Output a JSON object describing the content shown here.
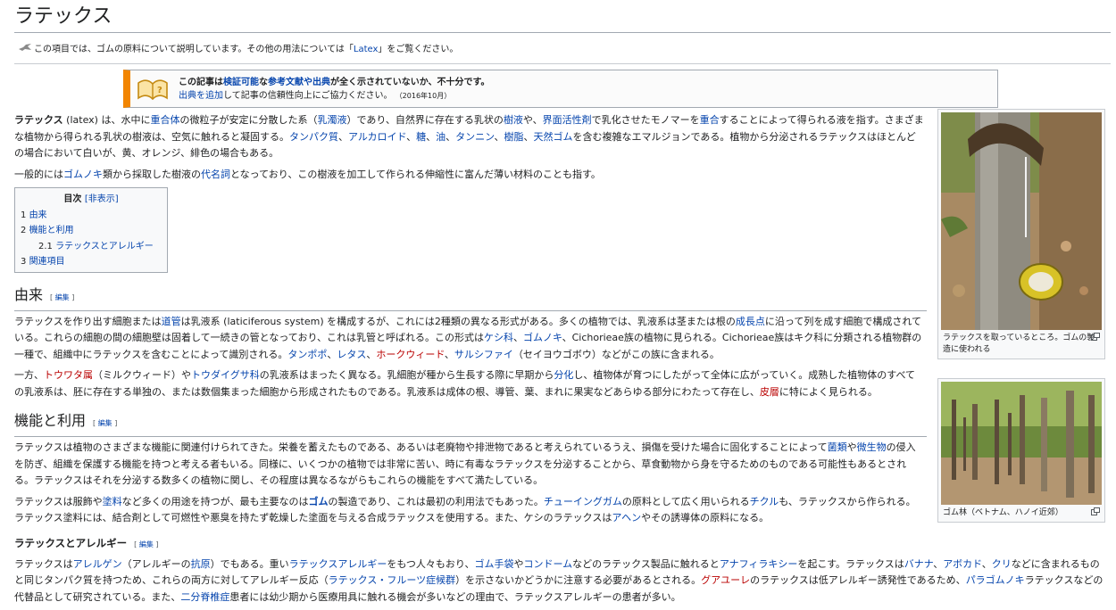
{
  "page_title": "ラテックス",
  "hatnote": {
    "text_pre": "この項目では、ゴムの原料について説明しています。その他の用法については「",
    "link": "Latex",
    "text_post": "」をご覧ください。"
  },
  "ambox": {
    "l1_a": "この記事は",
    "l1_link1": "検証可能",
    "l1_b": "な",
    "l1_link2": "参考文献や出典",
    "l1_c": "が全く示されていないか、不十分です。",
    "l2_link": "出典を追加",
    "l2_text": "して記事の信頼性向上にご協力ください。",
    "date": "（2016年10月）"
  },
  "intro": {
    "p1": [
      {
        "t": "ラテックス",
        "b": true
      },
      {
        "t": " (latex) は、水中に"
      },
      {
        "t": "重合体",
        "l": true
      },
      {
        "t": "の微粒子が安定に分散した系（"
      },
      {
        "t": "乳濁液",
        "l": true
      },
      {
        "t": "）であり、自然界に存在する乳状の"
      },
      {
        "t": "樹液",
        "l": true
      },
      {
        "t": "や、"
      },
      {
        "t": "界面活性剤",
        "l": true
      },
      {
        "t": "で乳化させたモノマーを"
      },
      {
        "t": "重合",
        "l": true
      },
      {
        "t": "することによって得られる液を指す。さまざまな植物から得られる乳状の樹液は、空気に触れると凝固する。"
      },
      {
        "t": "タンパク質",
        "l": true
      },
      {
        "t": "、"
      },
      {
        "t": "アルカロイド",
        "l": true
      },
      {
        "t": "、"
      },
      {
        "t": "糖",
        "l": true
      },
      {
        "t": "、"
      },
      {
        "t": "油",
        "l": true
      },
      {
        "t": "、"
      },
      {
        "t": "タンニン",
        "l": true
      },
      {
        "t": "、"
      },
      {
        "t": "樹脂",
        "l": true
      },
      {
        "t": "、"
      },
      {
        "t": "天然ゴム",
        "l": true
      },
      {
        "t": "を含む複雑なエマルジョンである。植物から分泌されるラテックスはほとんどの場合において白いが、黄、オレンジ、緋色の場合もある。"
      }
    ],
    "p2": [
      {
        "t": "一般的には"
      },
      {
        "t": "ゴムノキ",
        "l": true
      },
      {
        "t": "類から採取した樹液の"
      },
      {
        "t": "代名詞",
        "l": true
      },
      {
        "t": "となっており、この樹液を加工して作られる伸縮性に富んだ薄い材料のことも指す。"
      }
    ]
  },
  "toc": {
    "title": "目次",
    "toggle": "[非表示]",
    "items": [
      {
        "num": "1",
        "label": "由来"
      },
      {
        "num": "2",
        "label": "機能と利用"
      },
      {
        "num": "2.1",
        "label": "ラテックスとアレルギー"
      },
      {
        "num": "3",
        "label": "関連項目"
      }
    ]
  },
  "edit_label": "編集",
  "sec1": {
    "title": "由来",
    "p1": [
      {
        "t": "ラテックスを作り出す細胞または"
      },
      {
        "t": "道管",
        "l": true
      },
      {
        "t": "は乳液系 (laticiferous system) を構成するが、これには2種類の異なる形式がある。多くの植物では、乳液系は茎または根の"
      },
      {
        "t": "成長点",
        "l": true
      },
      {
        "t": "に沿って列を成す細胞で構成されている。これらの細胞の間の細胞壁は固着して一続きの管となっており、これは乳管と呼ばれる。この形式は"
      },
      {
        "t": "ケシ科",
        "l": true
      },
      {
        "t": "、"
      },
      {
        "t": "ゴムノキ",
        "l": true
      },
      {
        "t": "、Cichorieae族の植物に見られる。Cichorieae族はキク科に分類される植物群の一種で、組織中にラテックスを含むことによって識別される。"
      },
      {
        "t": "タンポポ",
        "l": true
      },
      {
        "t": "、"
      },
      {
        "t": "レタス",
        "l": true
      },
      {
        "t": "、"
      },
      {
        "t": "ホークウィード",
        "r": true
      },
      {
        "t": "、"
      },
      {
        "t": "サルシファイ",
        "l": true
      },
      {
        "t": "（セイヨウゴボウ）などがこの族に含まれる。"
      }
    ],
    "p2": [
      {
        "t": "一方、"
      },
      {
        "t": "トウワタ属",
        "r": true
      },
      {
        "t": "（ミルクウィード）や"
      },
      {
        "t": "トウダイグサ科",
        "l": true
      },
      {
        "t": "の乳液系はまったく異なる。乳細胞が種から生長する際に早期から"
      },
      {
        "t": "分化",
        "l": true
      },
      {
        "t": "し、植物体が育つにしたがって全体に広がっていく。成熟した植物体のすべての乳液系は、胚に存在する単独の、または数個集まった細胞から形成されたものである。乳液系は成体の根、導管、葉、まれに果実などあらゆる部分にわたって存在し、"
      },
      {
        "t": "皮層",
        "r": true
      },
      {
        "t": "に特によく見られる。"
      }
    ]
  },
  "sec2": {
    "title": "機能と利用",
    "p1": [
      {
        "t": "ラテックスは植物のさまざまな機能に関連付けられてきた。栄養を蓄えたものである、あるいは老廃物や排泄物であると考えられているうえ、損傷を受けた場合に固化することによって"
      },
      {
        "t": "菌類",
        "l": true
      },
      {
        "t": "や"
      },
      {
        "t": "微生物",
        "l": true
      },
      {
        "t": "の侵入を防ぎ、組織を保護する機能を持つと考える者もいる。同様に、いくつかの植物では非常に苦い、時に有毒なラテックスを分泌することから、草食動物から身を守るためのものである可能性もあるとされる。ラテックスはそれを分泌する数多くの植物に関し、その程度は異なるながらもこれらの機能をすべて満たしている。"
      }
    ],
    "p2": [
      {
        "t": "ラテックスは服飾や"
      },
      {
        "t": "塗料",
        "l": true
      },
      {
        "t": "など多くの用途を持つが、最も主要なのは"
      },
      {
        "t": "ゴム",
        "l": true,
        "b": true
      },
      {
        "t": "の製造であり、これは最初の利用法でもあった。"
      },
      {
        "t": "チューイングガム",
        "l": true
      },
      {
        "t": "の原料として広く用いられる"
      },
      {
        "t": "チクル",
        "l": true
      },
      {
        "t": "も、ラテックスから作られる。ラテックス塗料には、結合剤として可燃性や悪臭を持たず乾燥した塗面を与える合成ラテックスを使用する。また、ケシのラテックスは"
      },
      {
        "t": "アヘン",
        "l": true
      },
      {
        "t": "やその誘導体の原料になる。"
      }
    ]
  },
  "sec21": {
    "title": "ラテックスとアレルギー",
    "p1": [
      {
        "t": "ラテックスは"
      },
      {
        "t": "アレルゲン",
        "l": true
      },
      {
        "t": "（アレルギーの"
      },
      {
        "t": "抗原",
        "l": true
      },
      {
        "t": "）でもある。重い"
      },
      {
        "t": "ラテックスアレルギー",
        "l": true
      },
      {
        "t": "をもつ人々もおり、"
      },
      {
        "t": "ゴム手袋",
        "l": true
      },
      {
        "t": "や"
      },
      {
        "t": "コンドーム",
        "l": true
      },
      {
        "t": "などのラテックス製品に触れると"
      },
      {
        "t": "アナフィラキシー",
        "l": true
      },
      {
        "t": "を起こす。ラテックスは"
      },
      {
        "t": "バナナ",
        "l": true
      },
      {
        "t": "、"
      },
      {
        "t": "アボカド",
        "l": true
      },
      {
        "t": "、"
      },
      {
        "t": "クリ",
        "l": true
      },
      {
        "t": "などに含まれるものと同じタンパク質を持つため、これらの両方に対してアレルギー反応（"
      },
      {
        "t": "ラテックス・フルーツ症候群",
        "l": true
      },
      {
        "t": "）を示さないかどうかに注意する必要があるとされる。"
      },
      {
        "t": "グアユーレ",
        "r": true
      },
      {
        "t": "のラテックスは低アレルギー誘発性であるため、"
      },
      {
        "t": "パラゴムノキ",
        "l": true
      },
      {
        "t": "ラテックスなどの代替品として研究されている。また、"
      },
      {
        "t": "二分脊椎症",
        "l": true
      },
      {
        "t": "患者には幼少期から医療用具に触れる機会が多いなどの理由で、ラテックスアレルギーの患者が多い。"
      }
    ]
  },
  "thumb1": {
    "caption": "ラテックスを取っているところ。ゴムの製造に使われる"
  },
  "thumb2": {
    "caption": "ゴム林（ベトナム、ハノイ近郊）"
  },
  "colors": {
    "link": "#0645ad",
    "redlink": "#ba0000",
    "ambox_accent": "#f28500",
    "border": "#a2a9b1"
  }
}
